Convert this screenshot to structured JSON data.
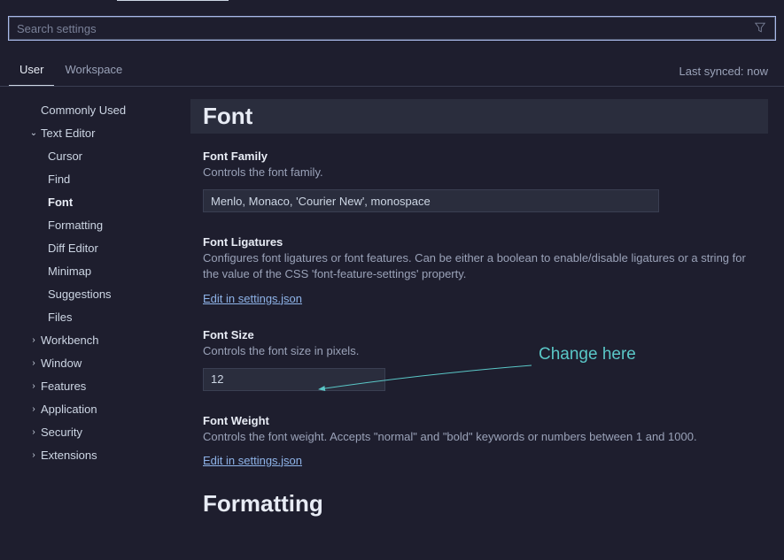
{
  "search": {
    "placeholder": "Search settings"
  },
  "scope": {
    "tabs": [
      "User",
      "Workspace"
    ],
    "sync_status": "Last synced: now"
  },
  "sidebar": {
    "items": [
      {
        "label": "Commonly Used",
        "level": 0,
        "expandable": false
      },
      {
        "label": "Text Editor",
        "level": 0,
        "expandable": true,
        "expanded": true
      },
      {
        "label": "Cursor",
        "level": 2,
        "expandable": false
      },
      {
        "label": "Find",
        "level": 2,
        "expandable": false
      },
      {
        "label": "Font",
        "level": 2,
        "expandable": false,
        "active": true
      },
      {
        "label": "Formatting",
        "level": 2,
        "expandable": false
      },
      {
        "label": "Diff Editor",
        "level": 2,
        "expandable": false
      },
      {
        "label": "Minimap",
        "level": 2,
        "expandable": false
      },
      {
        "label": "Suggestions",
        "level": 2,
        "expandable": false
      },
      {
        "label": "Files",
        "level": 2,
        "expandable": false
      },
      {
        "label": "Workbench",
        "level": 0,
        "expandable": true,
        "expanded": false
      },
      {
        "label": "Window",
        "level": 0,
        "expandable": true,
        "expanded": false
      },
      {
        "label": "Features",
        "level": 0,
        "expandable": true,
        "expanded": false
      },
      {
        "label": "Application",
        "level": 0,
        "expandable": true,
        "expanded": false
      },
      {
        "label": "Security",
        "level": 0,
        "expandable": true,
        "expanded": false
      },
      {
        "label": "Extensions",
        "level": 0,
        "expandable": true,
        "expanded": false
      }
    ]
  },
  "settings": {
    "section_title": "Font",
    "font_family": {
      "title": "Font Family",
      "desc": "Controls the font family.",
      "value": "Menlo, Monaco, 'Courier New', monospace"
    },
    "font_ligatures": {
      "title": "Font Ligatures",
      "desc": "Configures font ligatures or font features. Can be either a boolean to enable/disable ligatures or a string for the value of the CSS 'font-feature-settings' property.",
      "link": "Edit in settings.json"
    },
    "font_size": {
      "title": "Font Size",
      "desc": "Controls the font size in pixels.",
      "value": "12"
    },
    "font_weight": {
      "title": "Font Weight",
      "desc": "Controls the font weight. Accepts \"normal\" and \"bold\" keywords or numbers between 1 and 1000.",
      "link": "Edit in settings.json"
    },
    "next_section": "Formatting"
  },
  "annotation": {
    "label": "Change here"
  }
}
